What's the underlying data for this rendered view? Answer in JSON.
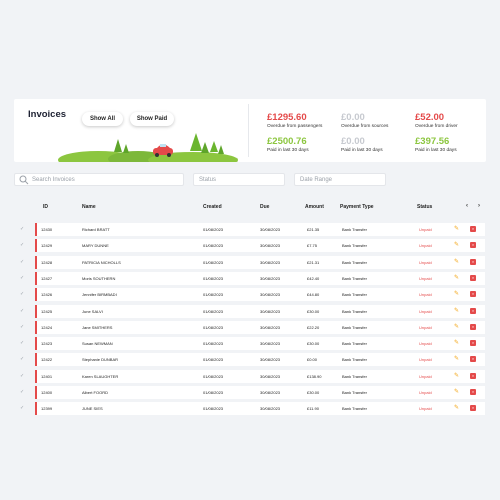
{
  "header": {
    "title": "Invoices",
    "show_all_label": "Show All",
    "show_paid_label": "Show Paid"
  },
  "stats": [
    {
      "amount": "£1295.60",
      "label": "Overdue from passengers",
      "color": "#e44a4a"
    },
    {
      "amount": "£0.00",
      "label": "Overdue from sources",
      "color": "#c7cad0"
    },
    {
      "amount": "£52.00",
      "label": "Overdue from driver",
      "color": "#e44a4a"
    },
    {
      "amount": "£2500.76",
      "label": "Paid in last 30 days",
      "color": "#8cc63f"
    },
    {
      "amount": "£0.00",
      "label": "Paid in last 30 days",
      "color": "#c7cad0"
    },
    {
      "amount": "£397.56",
      "label": "Paid in last 30 days",
      "color": "#8cc63f"
    }
  ],
  "filters": {
    "search_placeholder": "Search Invoices",
    "status_placeholder": "Status",
    "date_placeholder": "Date Range"
  },
  "table": {
    "columns": [
      "ID",
      "Name",
      "Created",
      "Due",
      "Amount",
      "Payment Type",
      "Status"
    ],
    "prev_label": "‹",
    "next_label": "›",
    "rows": [
      {
        "id": "12430",
        "name": "Richard BRATT",
        "created": "01/08/2023",
        "due": "30/08/2023",
        "amount": "£21.35",
        "payment": "Bank Transfer",
        "status": "Unpaid"
      },
      {
        "id": "12429",
        "name": "MARY DUNNE",
        "created": "01/08/2023",
        "due": "30/08/2023",
        "amount": "£7.75",
        "payment": "Bank Transfer",
        "status": "Unpaid"
      },
      {
        "id": "12428",
        "name": "PATRICIA NICHOLLS",
        "created": "01/08/2023",
        "due": "30/08/2023",
        "amount": "£21.31",
        "payment": "Bank Transfer",
        "status": "Unpaid"
      },
      {
        "id": "12427",
        "name": "Moris SOUTHERN",
        "created": "01/08/2023",
        "due": "30/08/2023",
        "amount": "£42.40",
        "payment": "Bank Transfer",
        "status": "Unpaid"
      },
      {
        "id": "12426",
        "name": "Jennifer BIRMBADI",
        "created": "01/08/2023",
        "due": "30/08/2023",
        "amount": "£44.80",
        "payment": "Bank Transfer",
        "status": "Unpaid"
      },
      {
        "id": "12425",
        "name": "June SALVI",
        "created": "01/08/2023",
        "due": "30/08/2023",
        "amount": "£30.00",
        "payment": "Bank Transfer",
        "status": "Unpaid"
      },
      {
        "id": "12424",
        "name": "Jane SMITHERS",
        "created": "01/08/2023",
        "due": "30/08/2023",
        "amount": "£22.20",
        "payment": "Bank Transfer",
        "status": "Unpaid"
      },
      {
        "id": "12423",
        "name": "Susan NEWMAN",
        "created": "01/08/2023",
        "due": "30/08/2023",
        "amount": "£30.00",
        "payment": "Bank Transfer",
        "status": "Unpaid"
      },
      {
        "id": "12422",
        "name": "Stephanie DUNBAR",
        "created": "01/08/2023",
        "due": "30/08/2023",
        "amount": "£0.00",
        "payment": "Bank Transfer",
        "status": "Unpaid"
      },
      {
        "id": "12401",
        "name": "Karen SLAUGHTER",
        "created": "01/08/2023",
        "due": "30/08/2023",
        "amount": "£138.90",
        "payment": "Bank Transfer",
        "status": "Unpaid"
      },
      {
        "id": "12400",
        "name": "Albert FOORD",
        "created": "01/08/2023",
        "due": "30/08/2023",
        "amount": "£30.00",
        "payment": "Bank Transfer",
        "status": "Unpaid"
      },
      {
        "id": "12399",
        "name": "JUNE SIES",
        "created": "01/08/2023",
        "due": "30/08/2023",
        "amount": "£11.90",
        "payment": "Bank Transfer",
        "status": "Unpaid"
      }
    ]
  },
  "icons": {
    "search": "search-icon",
    "check": "checkmark-icon",
    "edit": "pencil-icon",
    "delete": "delete-icon"
  }
}
